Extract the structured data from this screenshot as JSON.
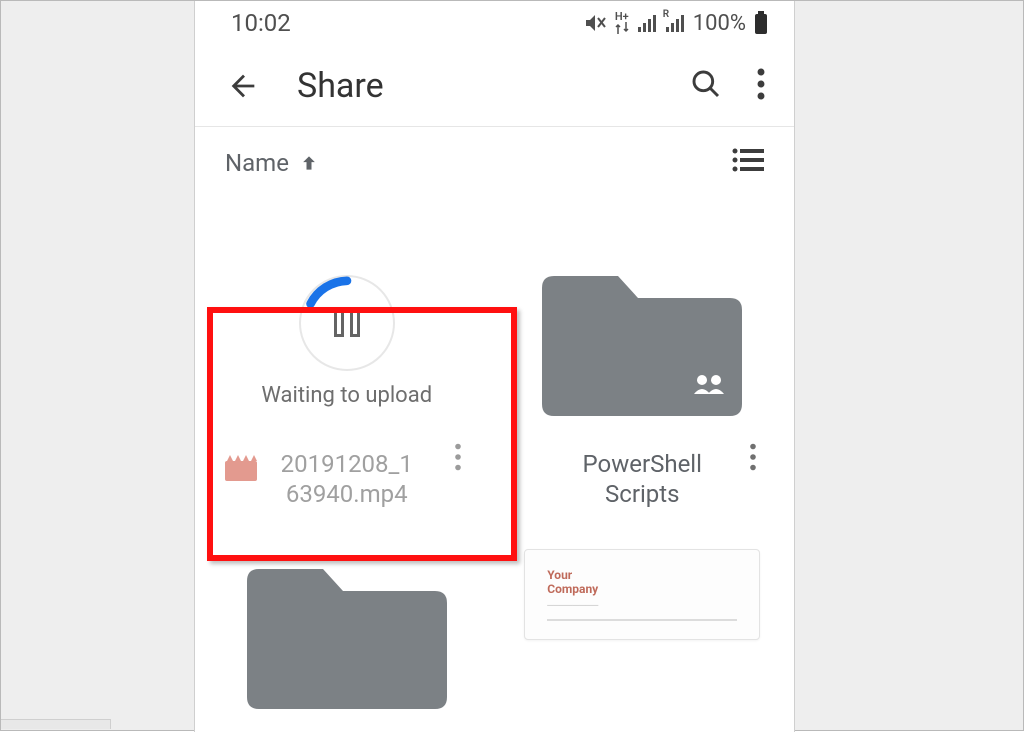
{
  "statusbar": {
    "time": "10:02",
    "network_hplus": "H+",
    "network_r": "R",
    "battery_text": "100%"
  },
  "appbar": {
    "title": "Share"
  },
  "sort": {
    "label": "Name"
  },
  "items": {
    "upload": {
      "status": "Waiting to upload",
      "filename": "20191208_1\n63940.mp4"
    },
    "folder1": {
      "name": "PowerShell\nScripts"
    },
    "doc_preview": {
      "line1": "Your",
      "line2": "Company"
    }
  }
}
